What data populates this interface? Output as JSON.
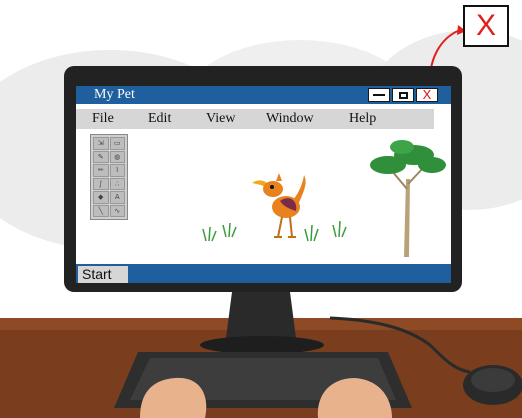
{
  "window": {
    "title": "My Pet",
    "minimize_icon": "minimize-icon",
    "maximize_icon": "maximize-icon",
    "close_label": "X"
  },
  "menu": {
    "items": [
      "File",
      "Edit",
      "View",
      "Window",
      "Help"
    ]
  },
  "toolbox": {
    "tools": [
      "select-tool",
      "rect-select-tool",
      "lasso-tool",
      "zoom-tool",
      "pencil-tool",
      "eyedropper-tool",
      "brush-tool",
      "spray-tool",
      "fill-tool",
      "text-tool",
      "line-tool",
      "curve-tool"
    ]
  },
  "taskbar": {
    "start_label": "Start"
  },
  "callout": {
    "label": "X"
  },
  "colors": {
    "titlebar": "#1f5f9e",
    "menubar": "#d6d6d6",
    "close_highlight": "#d11a1a",
    "desk": "#7a3e1e"
  }
}
